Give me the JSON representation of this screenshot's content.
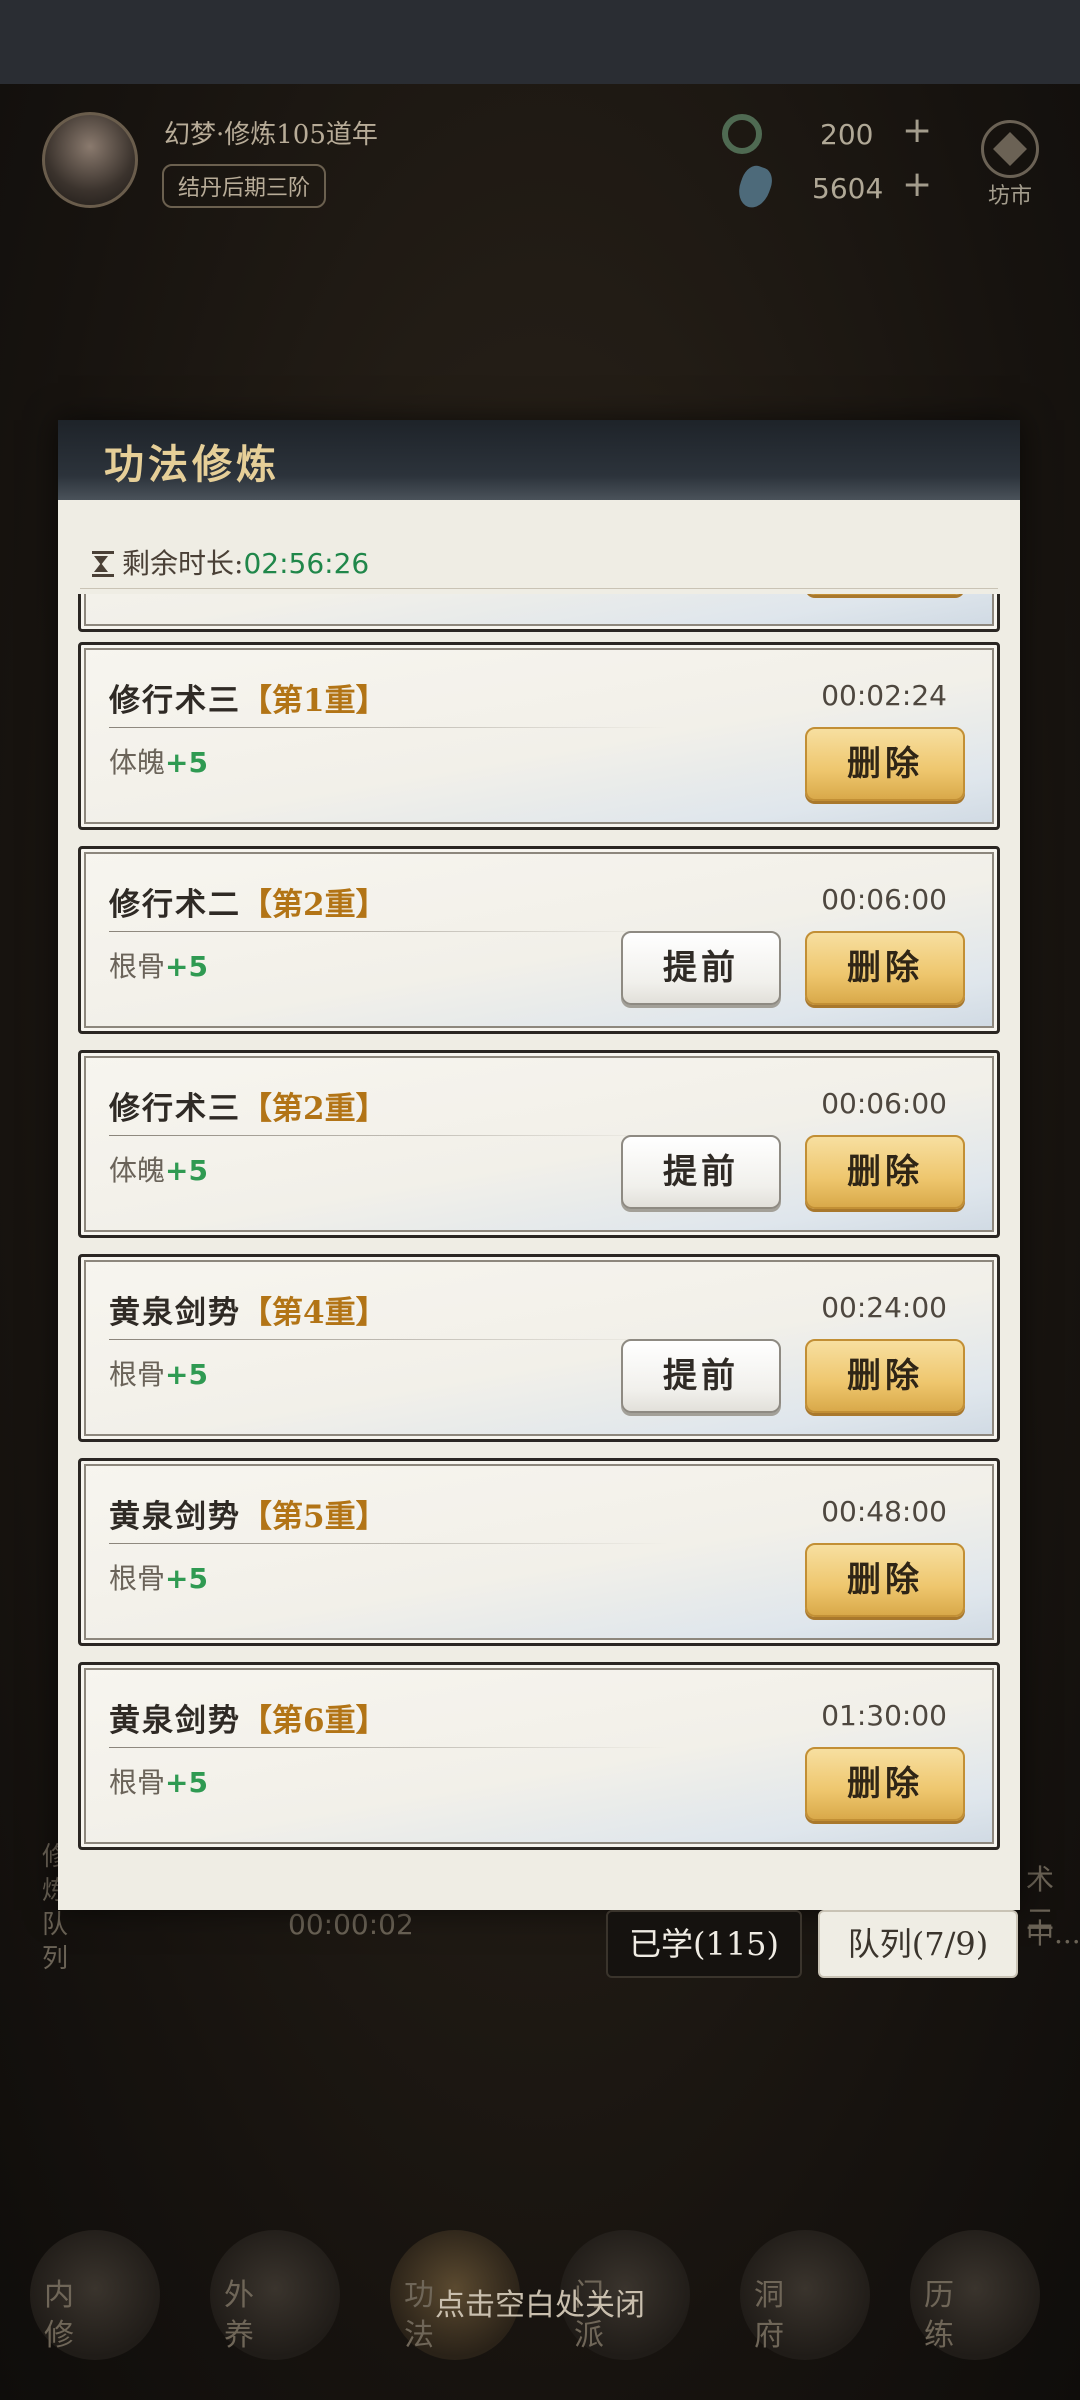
{
  "player": {
    "name": "幻梦·修炼105道年",
    "realm": "结丹后期三阶"
  },
  "resources": [
    {
      "icon": "jade-ring-icon",
      "value": "200",
      "plus": "+"
    },
    {
      "icon": "spirit-stone-icon",
      "value": "5604",
      "plus": "+"
    }
  ],
  "market": {
    "label": "坊市",
    "icon": "market-icon"
  },
  "modal": {
    "title": "功法修炼",
    "remaining_label": "剩余时长:",
    "remaining_time": "02:56:26",
    "items": [
      {
        "name": "修行术三",
        "level": "【第1重】",
        "attr": "体魄",
        "bonus": "+5",
        "time": "00:02:24",
        "advance": null,
        "delete": "删除"
      },
      {
        "name": "修行术二",
        "level": "【第2重】",
        "attr": "根骨",
        "bonus": "+5",
        "time": "00:06:00",
        "advance": "提前",
        "delete": "删除"
      },
      {
        "name": "修行术三",
        "level": "【第2重】",
        "attr": "体魄",
        "bonus": "+5",
        "time": "00:06:00",
        "advance": "提前",
        "delete": "删除"
      },
      {
        "name": "黄泉剑势",
        "level": "【第4重】",
        "attr": "根骨",
        "bonus": "+5",
        "time": "00:24:00",
        "advance": "提前",
        "delete": "删除"
      },
      {
        "name": "黄泉剑势",
        "level": "【第5重】",
        "attr": "根骨",
        "bonus": "+5",
        "time": "00:48:00",
        "advance": null,
        "delete": "删除"
      },
      {
        "name": "黄泉剑势",
        "level": "【第6重】",
        "attr": "根骨",
        "bonus": "+5",
        "time": "01:30:00",
        "advance": null,
        "delete": "删除"
      }
    ]
  },
  "tabs": {
    "learned": "已学(115)",
    "queue": "队列(7/9)"
  },
  "background": {
    "queue_timer": "00:00:02",
    "side_left": "修炼队列",
    "side_right": "术二",
    "side_right_sub": "中..."
  },
  "close_hint": "点击空白处关闭",
  "nav": [
    "内修",
    "外养",
    "功法",
    "门派",
    "洞府",
    "历练"
  ]
}
